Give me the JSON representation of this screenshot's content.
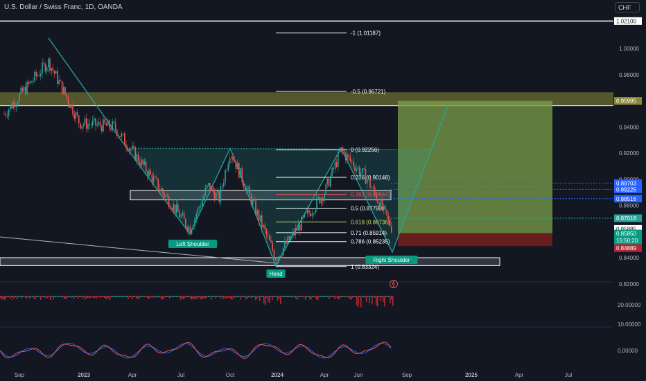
{
  "header": {
    "symbol": "U.S. Dollar / Swiss Franc, 1D, OANDA",
    "currency_button": "CHF"
  },
  "colors": {
    "background": "#131722",
    "candle_up": "#26a69a",
    "candle_down": "#ef5350",
    "pattern": "#26a69a",
    "supply_zone": "#8a8a35",
    "target_zone": "#7ba049",
    "stop_zone": "#6b1f1f",
    "text": "#d1d4dc"
  },
  "chart_data": {
    "type": "line",
    "title": "U.S. Dollar / Swiss Franc, 1D, OANDA",
    "y_axis": {
      "ticks": [
        "1.00000",
        "0.98000",
        "0.96000",
        "0.94000",
        "0.92000",
        "0.90000",
        "0.88000",
        "0.86000",
        "0.84000",
        "0.82000"
      ],
      "range": [
        0.8148,
        1.0343
      ]
    },
    "x_axis": {
      "ticks": [
        "Sep",
        "2023",
        "Apr",
        "Jul",
        "Oct",
        "2024",
        "Apr",
        "Jun",
        "Sep",
        "2025",
        "Apr",
        "Jul"
      ]
    },
    "price_key_points": {
      "x": [
        "Sep",
        "Nov",
        "Dec",
        "Mar",
        "May",
        "Jul",
        "Aug",
        "Sep",
        "Oct",
        "2024",
        "Apr",
        "May",
        "Jul",
        "Aug"
      ],
      "y": [
        0.95,
        0.99,
        0.943,
        0.94,
        0.895,
        0.862,
        0.895,
        0.885,
        0.922,
        0.84,
        0.89,
        0.922,
        0.9,
        0.862
      ]
    },
    "fibonacci_levels": [
      {
        "label": "-1 (1.01187)",
        "value": 1.01187
      },
      {
        "label": "-0.5 (0.96721)",
        "value": 0.96721
      },
      {
        "label": "0 (0.92256)",
        "value": 0.92256
      },
      {
        "label": "0.236 (0.90148)",
        "value": 0.90148
      },
      {
        "label": "0.382 (0.88844)",
        "value": 0.88844
      },
      {
        "label": "0.5 (0.87790)",
        "value": 0.8779
      },
      {
        "label": "0.618 (0.86736)",
        "value": 0.86736
      },
      {
        "label": "0.71 (0.85914)",
        "value": 0.85914
      },
      {
        "label": "0.786 (0.85235)",
        "value": 0.85235
      },
      {
        "label": "1 (0.83324)",
        "value": 0.83324
      }
    ],
    "pattern_labels": [
      "Left Shoulder",
      "Head",
      "Right Shoulder"
    ],
    "price_labels": [
      {
        "text": "1.02100",
        "value": 1.021,
        "style": "white"
      },
      {
        "text": "0.95995",
        "value": 0.95995,
        "style": "olive"
      },
      {
        "text": "0.89703",
        "value": 0.89703,
        "style": "blue"
      },
      {
        "text": "0.89225",
        "value": 0.89225,
        "style": "blue"
      },
      {
        "text": "0.88516",
        "value": 0.88516,
        "style": "blue"
      },
      {
        "text": "0.87018",
        "value": 0.87018,
        "style": "green"
      },
      {
        "text": "0.85885",
        "value": 0.85885,
        "style": "white"
      },
      {
        "text": "0.85850",
        "value": 0.8585,
        "style": "teal"
      },
      {
        "text": "15:50:20",
        "value": 0.8585,
        "style": "teal_sub"
      },
      {
        "text": "0.84889",
        "value": 0.84889,
        "style": "red"
      }
    ],
    "sub_pane_ticks": [
      "20.00000",
      "10.00000",
      "0.00000"
    ]
  }
}
